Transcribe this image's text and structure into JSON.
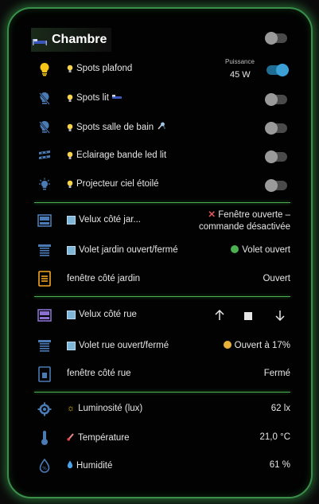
{
  "header": {
    "title": "Chambre"
  },
  "lights": [
    {
      "label": "Spots plafond",
      "extra": "",
      "on": true
    },
    {
      "label": "Spots lit",
      "extra": "bed",
      "on": false
    },
    {
      "label": "Spots salle de bain",
      "extra": "shower",
      "on": false
    },
    {
      "label": "Eclairage bande led lit",
      "extra": "",
      "on": false
    },
    {
      "label": "Projecteur ciel étoilé",
      "extra": "",
      "on": false
    }
  ],
  "power": {
    "label": "Puissance",
    "value": "45 W"
  },
  "garden": {
    "velux_label": "Velux côté jar...",
    "velux_state": "Fenêtre ouverte – commande désactivée",
    "volet_label": "Volet jardin ouvert/fermé",
    "volet_state": "Volet ouvert",
    "window_label": "fenêtre côté jardin",
    "window_state": "Ouvert"
  },
  "street": {
    "velux_label": "Velux côté rue",
    "volet_label": "Volet rue ouvert/fermé",
    "volet_state": "Ouvert à 17%",
    "window_label": "fenêtre côté rue",
    "window_state": "Fermé"
  },
  "sensors": [
    {
      "label": "Luminosité (lux)",
      "value": "62 lx"
    },
    {
      "label": "Température",
      "value": "21,0 °C"
    },
    {
      "label": "Humidité",
      "value": "61 %"
    }
  ],
  "colors": {
    "border": "#3a8f4a",
    "bulb_on": "#f5c518",
    "icon_blue": "#4b7bb5",
    "toggle_on": "#3aa0d6",
    "cover_open": "#4caf50",
    "cover_partial": "#e8b23a",
    "purple": "#8a6fd1",
    "orange": "#f5a623"
  }
}
